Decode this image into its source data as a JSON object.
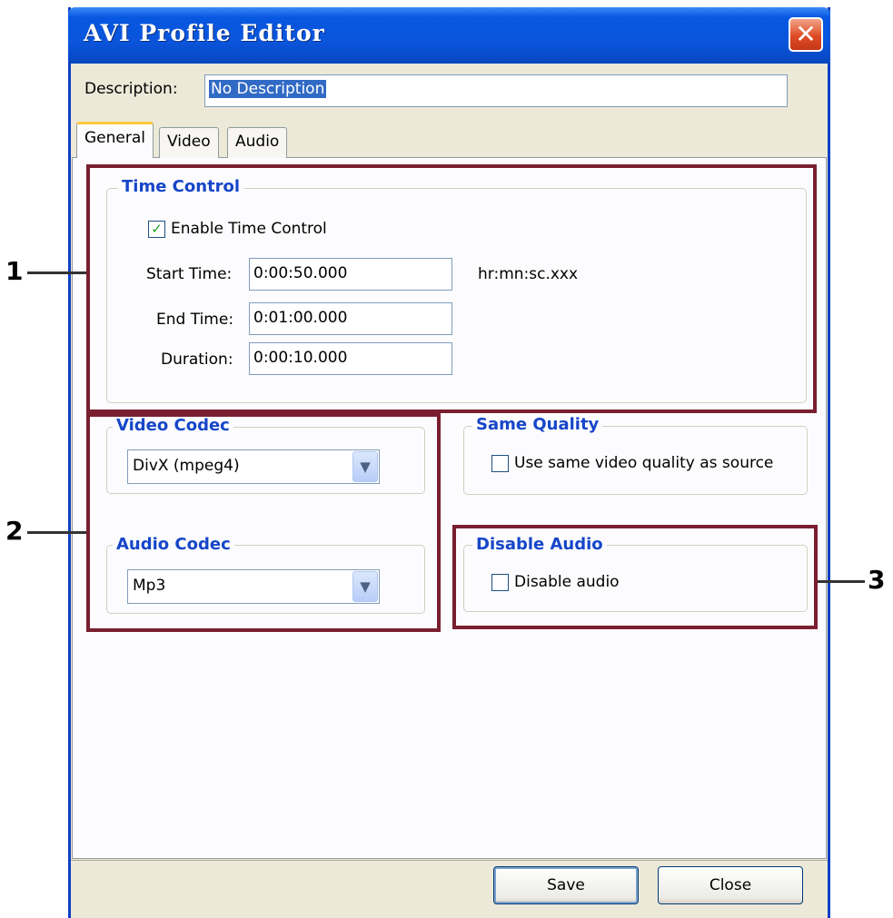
{
  "window": {
    "title": "AVI Profile Editor",
    "close_glyph": "✕"
  },
  "description": {
    "label": "Description:",
    "value": "No Description"
  },
  "tabs": [
    {
      "label": "General",
      "active": true
    },
    {
      "label": "Video",
      "active": false
    },
    {
      "label": "Audio",
      "active": false
    }
  ],
  "time_control": {
    "title": "Time Control",
    "enable_label": "Enable Time Control",
    "enable_checked": true,
    "start_label": "Start Time:",
    "start_value": "0:00:50.000",
    "format_hint": "hr:mn:sc.xxx",
    "end_label": "End Time:",
    "end_value": "0:01:00.000",
    "duration_label": "Duration:",
    "duration_value": "0:00:10.000"
  },
  "video_codec": {
    "title": "Video Codec",
    "selected": "DivX (mpeg4)"
  },
  "audio_codec": {
    "title": "Audio Codec",
    "selected": "Mp3"
  },
  "same_quality": {
    "title": "Same Quality",
    "label": "Use same video quality as source",
    "checked": false
  },
  "disable_audio": {
    "title": "Disable Audio",
    "label": "Disable audio",
    "checked": false
  },
  "buttons": {
    "save": "Save",
    "close": "Close"
  },
  "callouts": {
    "one": "1",
    "two": "2",
    "three": "3"
  },
  "colors": {
    "titlebar": "#0a55dc",
    "group_title": "#1646c8",
    "callout_box": "#7a1f30",
    "dialog_bg": "#ece9d8"
  },
  "icons": {
    "checkmark": "✓",
    "dropdown": "chevron-down-icon"
  }
}
